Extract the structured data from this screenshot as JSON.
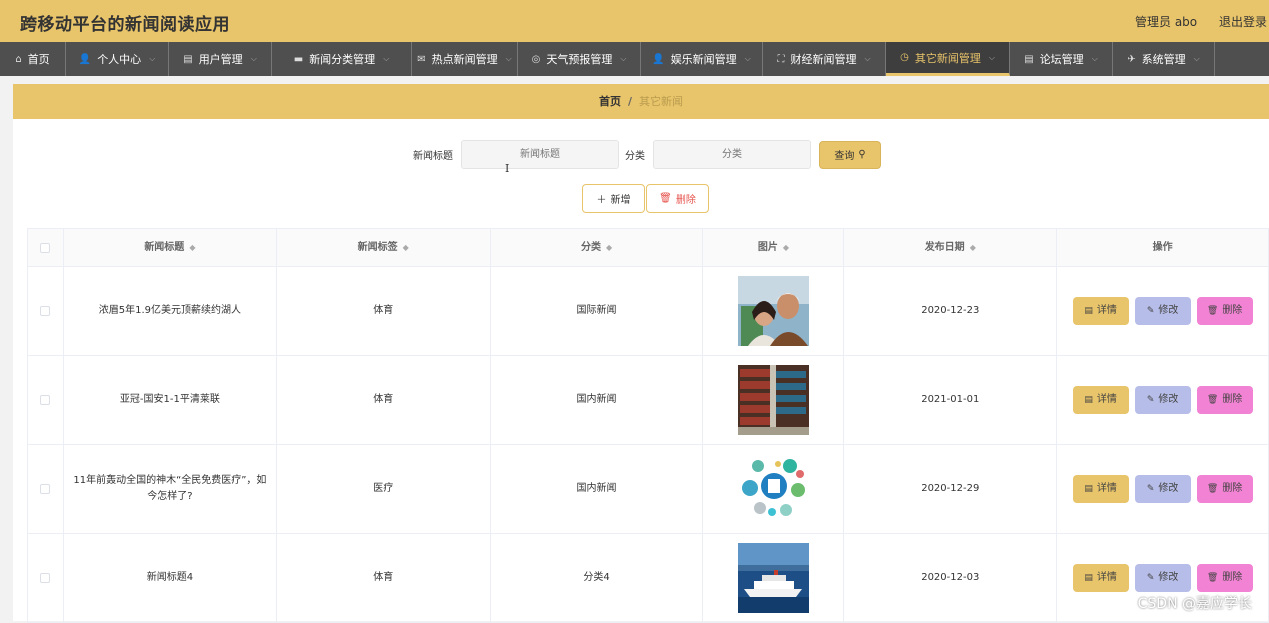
{
  "app": {
    "title": "跨移动平台的新闻阅读应用",
    "user_label": "管理员 abo",
    "logout_label": "退出登录"
  },
  "nav": [
    {
      "label": "首页",
      "icon": "home-icon",
      "glyph": "⌂"
    },
    {
      "label": "个人中心",
      "icon": "user-icon",
      "glyph": "👤"
    },
    {
      "label": "用户管理",
      "icon": "clipboard-icon",
      "glyph": "▤"
    },
    {
      "label": "新闻分类管理",
      "icon": "folder-icon",
      "glyph": "▬"
    },
    {
      "label": "热点新闻管理",
      "icon": "mail-icon",
      "glyph": "✉"
    },
    {
      "label": "天气预报管理",
      "icon": "target-icon",
      "glyph": "◎"
    },
    {
      "label": "娱乐新闻管理",
      "icon": "user-icon",
      "glyph": "👤"
    },
    {
      "label": "财经新闻管理",
      "icon": "frame-icon",
      "glyph": "⛶"
    },
    {
      "label": "其它新闻管理",
      "icon": "clock-icon",
      "glyph": "◷",
      "active": true
    },
    {
      "label": "论坛管理",
      "icon": "clipboard-icon",
      "glyph": "▤"
    },
    {
      "label": "系统管理",
      "icon": "tickets-icon",
      "glyph": "✈"
    }
  ],
  "breadcrumb": {
    "home": "首页",
    "separator": "/",
    "current": "其它新闻"
  },
  "search": {
    "title_label": "新闻标题",
    "title_placeholder": "新闻标题",
    "category_label": "分类",
    "category_placeholder": "分类",
    "query_label": "查询"
  },
  "actions": {
    "add_label": "新增",
    "delete_label": "删除"
  },
  "table": {
    "headers": [
      "新闻标题",
      "新闻标签",
      "分类",
      "图片",
      "发布日期",
      "操作"
    ],
    "rows": [
      {
        "title": "浓眉5年1.9亿美元顶薪续约湖人",
        "tag": "体育",
        "category": "国际新闻",
        "date": "2020-12-23"
      },
      {
        "title": "亚冠-国安1-1平清莱联",
        "tag": "体育",
        "category": "国内新闻",
        "date": "2021-01-01"
      },
      {
        "title": "11年前轰动全国的神木“全民免费医疗”，如今怎样了?",
        "tag": "医疗",
        "category": "国内新闻",
        "date": "2020-12-29"
      },
      {
        "title": "新闻标题4",
        "tag": "体育",
        "category": "分类4",
        "date": "2020-12-03"
      }
    ],
    "op_labels": {
      "detail": "详情",
      "edit": "修改",
      "delete": "删除"
    }
  },
  "watermark": "CSDN @嘉应学长",
  "colors": {
    "accent": "#e8c46a",
    "nav_bg": "#4f4f4f",
    "edit": "#b6bde8",
    "delete": "#f282d3",
    "danger_text": "#e6524c"
  }
}
